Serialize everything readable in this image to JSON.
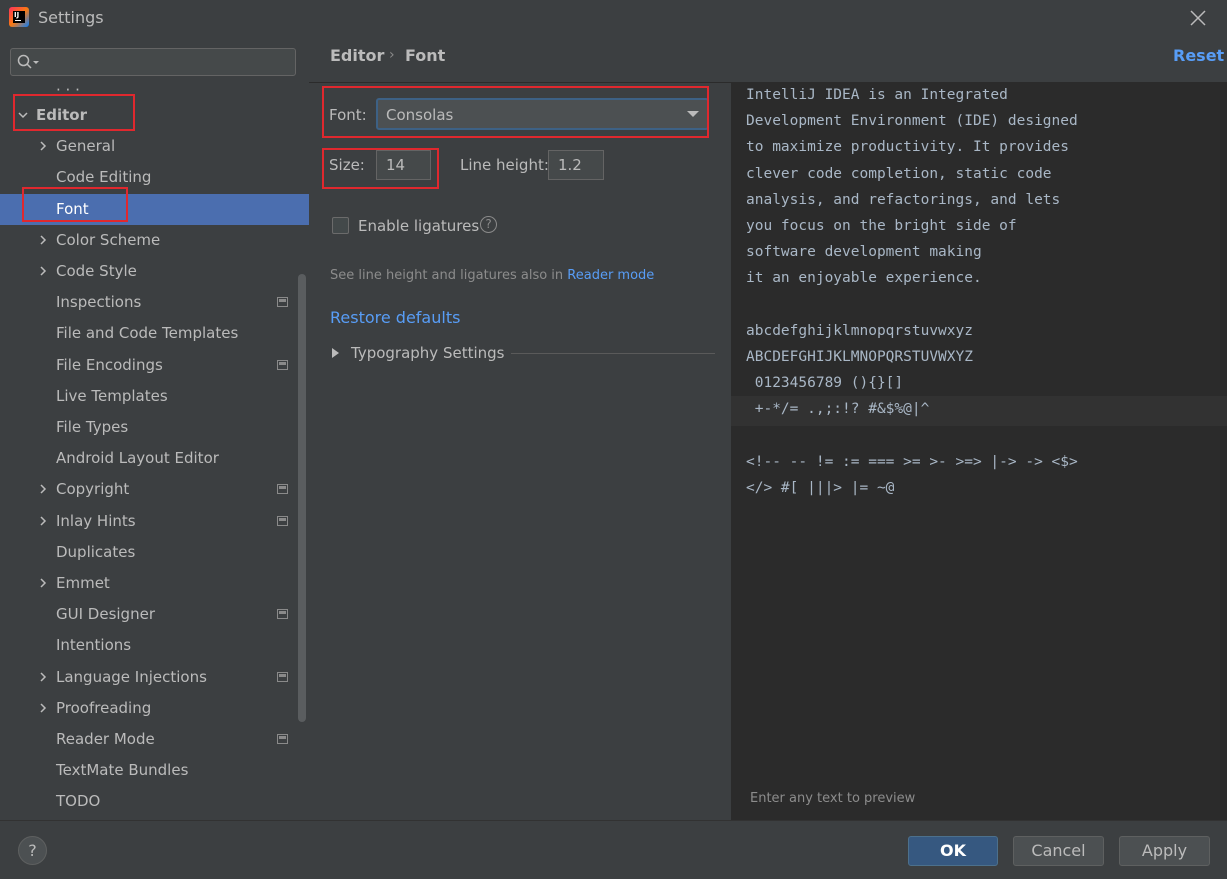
{
  "window": {
    "title": "Settings"
  },
  "search": {
    "placeholder": ""
  },
  "sidebar": {
    "items": [
      {
        "label": "Editor",
        "arrow": "expanded",
        "config": false
      },
      {
        "label": "General",
        "arrow": "collapsed",
        "config": false
      },
      {
        "label": "Code Editing",
        "arrow": "none",
        "config": false
      },
      {
        "label": "Font",
        "arrow": "none",
        "config": false,
        "selected": true
      },
      {
        "label": "Color Scheme",
        "arrow": "collapsed",
        "config": false
      },
      {
        "label": "Code Style",
        "arrow": "collapsed",
        "config": false
      },
      {
        "label": "Inspections",
        "arrow": "none",
        "config": true
      },
      {
        "label": "File and Code Templates",
        "arrow": "none",
        "config": false
      },
      {
        "label": "File Encodings",
        "arrow": "none",
        "config": true
      },
      {
        "label": "Live Templates",
        "arrow": "none",
        "config": false
      },
      {
        "label": "File Types",
        "arrow": "none",
        "config": false
      },
      {
        "label": "Android Layout Editor",
        "arrow": "none",
        "config": false
      },
      {
        "label": "Copyright",
        "arrow": "collapsed",
        "config": true
      },
      {
        "label": "Inlay Hints",
        "arrow": "collapsed",
        "config": true
      },
      {
        "label": "Duplicates",
        "arrow": "none",
        "config": false
      },
      {
        "label": "Emmet",
        "arrow": "collapsed",
        "config": false
      },
      {
        "label": "GUI Designer",
        "arrow": "none",
        "config": true
      },
      {
        "label": "Intentions",
        "arrow": "none",
        "config": false
      },
      {
        "label": "Language Injections",
        "arrow": "collapsed",
        "config": true
      },
      {
        "label": "Proofreading",
        "arrow": "collapsed",
        "config": false
      },
      {
        "label": "Reader Mode",
        "arrow": "none",
        "config": true
      },
      {
        "label": "TextMate Bundles",
        "arrow": "none",
        "config": false
      },
      {
        "label": "TODO",
        "arrow": "none",
        "config": false
      }
    ]
  },
  "header": {
    "breadcrumb": [
      "Editor",
      "Font"
    ],
    "separator": "›",
    "reset": "Reset"
  },
  "settings": {
    "font_label": "Font:",
    "font_value": "Consolas",
    "size_label": "Size:",
    "size_value": "14",
    "line_height_label": "Line height:",
    "line_height_value": "1.2",
    "ligatures_label": "Enable ligatures",
    "ligatures_checked": false,
    "hint_text": "See line height and ligatures also in ",
    "hint_link": "Reader mode",
    "restore_defaults": "Restore defaults",
    "typography": "Typography Settings"
  },
  "preview": {
    "lines": [
      "IntelliJ IDEA is an Integrated",
      "Development Environment (IDE) designed",
      "to maximize productivity. It provides",
      "clever code completion, static code",
      "analysis, and refactorings, and lets",
      "you focus on the bright side of",
      "software development making",
      "it an enjoyable experience.",
      "",
      "abcdefghijklmnopqrstuvwxyz",
      "ABCDEFGHIJKLMNOPQRSTUVWXYZ",
      " 0123456789 (){}[]",
      " +-*/= .,;:!? #&$%@|^",
      "",
      "<!-- -- != := === >= >- >=> |-> -> <$>",
      "</> #[ |||> |= ~@"
    ],
    "footer": "Enter any text to preview"
  },
  "buttons": {
    "help": "?",
    "ok": "OK",
    "cancel": "Cancel",
    "apply": "Apply"
  },
  "colors": {
    "accent": "#589df6",
    "selection": "#4b6eaf",
    "annotation": "#e0282e"
  }
}
